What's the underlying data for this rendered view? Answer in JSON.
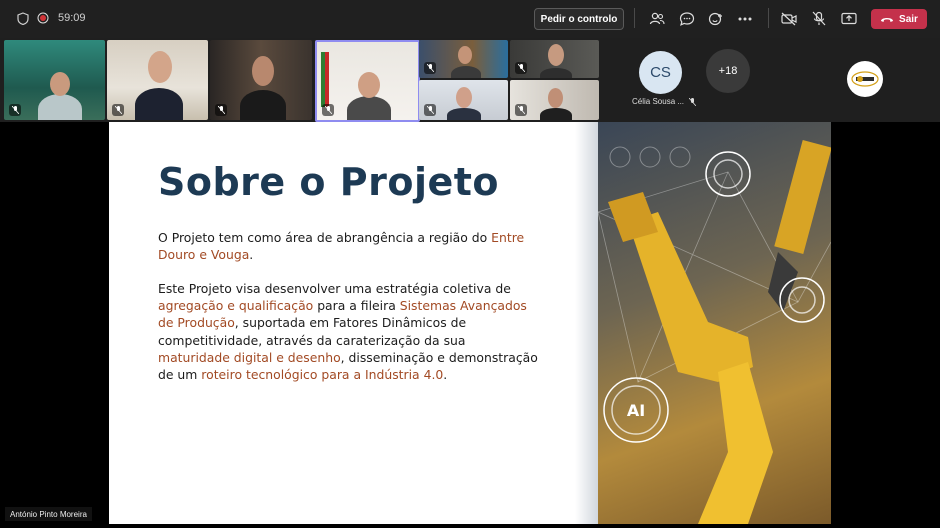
{
  "meeting": {
    "timer": "59:09",
    "request_control_label": "Pedir o controlo",
    "leave_label": "Sair"
  },
  "participants": {
    "avatar_initials": "CS",
    "avatar_name": "Célia Sousa ...",
    "overflow_count": "+18"
  },
  "slide": {
    "title": "Sobre o Projeto",
    "p1_text1": "O Projeto tem como área de abrangência a região do ",
    "p1_hl1": "Entre Douro e Vouga",
    "p1_text2": ".",
    "p2_text1": "Este Projeto visa desenvolver uma estratégia coletiva de ",
    "p2_hl1": "agregação e qualificação",
    "p2_text2": " para a fileira ",
    "p2_hl2": "Sistemas Avançados de Produção",
    "p2_text3": ", suportada em Fatores Dinâmicos de competitividade, através da caraterização da sua ",
    "p2_hl3": "maturidade digital e desenho",
    "p2_text4": ", disseminação e demonstração de um ",
    "p2_hl4": "roteiro tecnológico para a Indústria 4.0",
    "p2_text5": ".",
    "image_icon_text": "AI"
  },
  "presenter": {
    "name": "António Pinto Moreira"
  },
  "colors": {
    "title": "#1d3a54",
    "highlight": "#a24a24",
    "leave": "#c4314b"
  }
}
